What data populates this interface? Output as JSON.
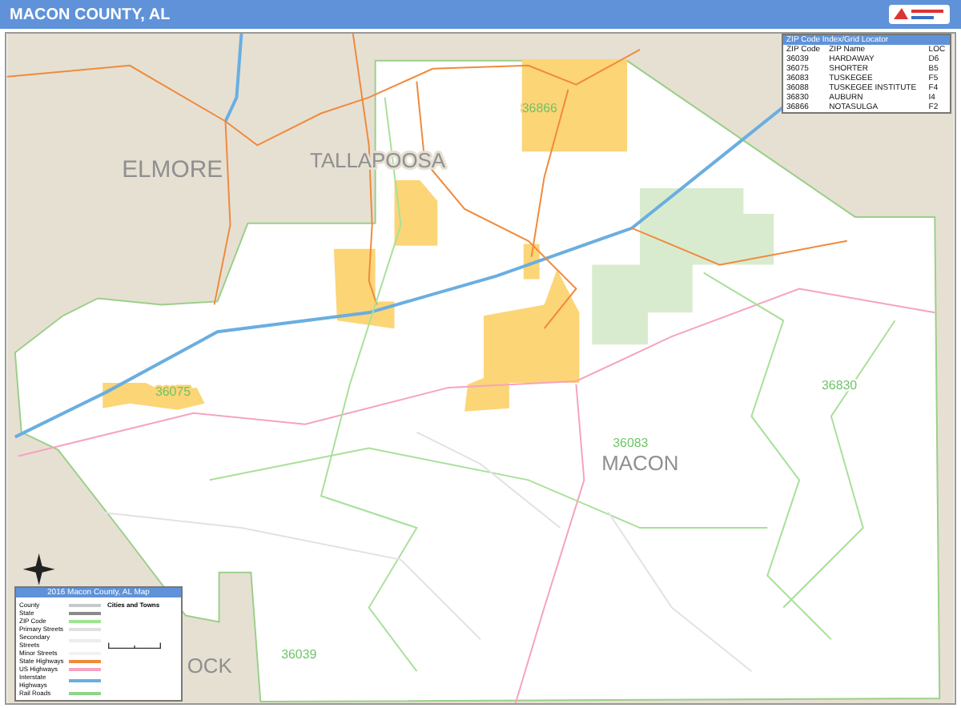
{
  "header": {
    "title": "MACON COUNTY, AL"
  },
  "map": {
    "county_labels": [
      "ELMORE",
      "TALLAPOOSA",
      "MACON",
      "OCK"
    ],
    "zip_labels": [
      "36866",
      "36075",
      "36830",
      "36083",
      "36039"
    ]
  },
  "zip_index": {
    "title": "ZIP Code Index/Grid Locator",
    "columns": [
      "ZIP Code",
      "ZIP Name",
      "LOC"
    ],
    "rows": [
      [
        "36039",
        "HARDAWAY",
        "D6"
      ],
      [
        "36075",
        "SHORTER",
        "B5"
      ],
      [
        "36083",
        "TUSKEGEE",
        "F5"
      ],
      [
        "36088",
        "TUSKEGEE INSTITUTE",
        "F4"
      ],
      [
        "36830",
        "AUBURN",
        "I4"
      ],
      [
        "36866",
        "NOTASULGA",
        "F2"
      ]
    ]
  },
  "legend": {
    "title": "2016 Macon County, AL Map",
    "cities_title": "Cities and Towns",
    "items": [
      "County",
      "State",
      "ZIP Code",
      "Primary Streets",
      "Secondary Streets",
      "Minor Streets",
      "State Highways",
      "US Highways",
      "Interstate Highways",
      "Rail Roads"
    ]
  }
}
